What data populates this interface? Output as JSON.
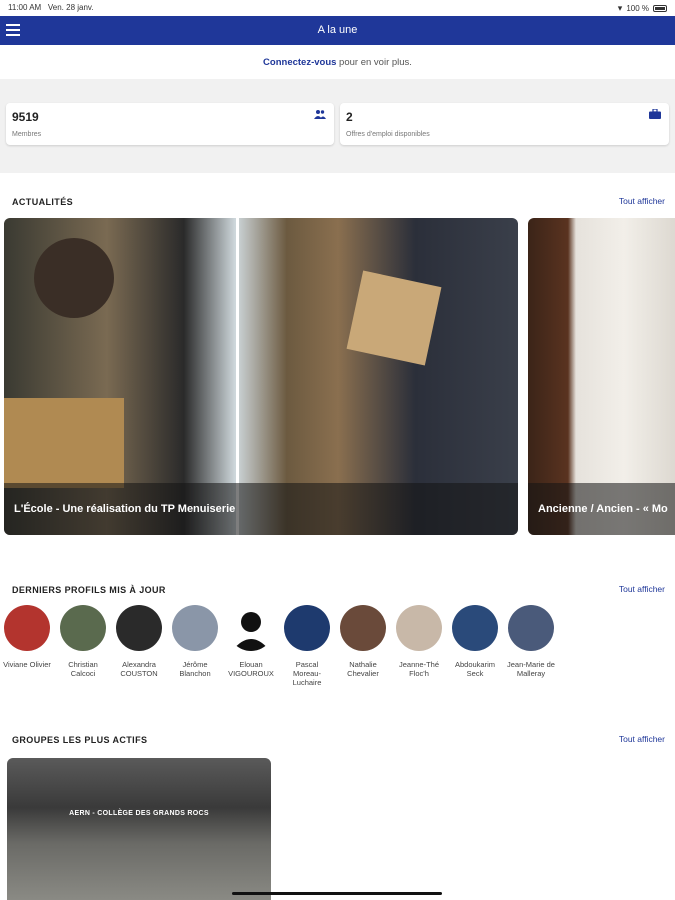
{
  "status": {
    "time": "11:00 AM",
    "date": "Ven. 28 janv.",
    "battery": "100 %"
  },
  "appbar": {
    "title": "A la une"
  },
  "connect": {
    "link": "Connectez-vous",
    "rest": " pour en voir plus."
  },
  "stats": {
    "members": {
      "value": "9519",
      "label": "Membres",
      "icon": "people-icon"
    },
    "jobs": {
      "value": "2",
      "label": "Offres d'emploi disponibles",
      "icon": "briefcase-icon"
    }
  },
  "news": {
    "title": "ACTUALITÉS",
    "see_all": "Tout afficher",
    "items": [
      {
        "caption": "L'École - Une réalisation du TP Menuiserie"
      },
      {
        "caption": "Ancienne / Ancien - « Mo"
      }
    ]
  },
  "profiles": {
    "title": "DERNIERS PROFILS MIS À JOUR",
    "see_all": "Tout afficher",
    "items": [
      {
        "name": "Viviane Olivier",
        "color": "#b3342e"
      },
      {
        "name": "Christian Calcoci",
        "color": "#5a6a4e"
      },
      {
        "name": "Alexandra COUSTON",
        "color": "#2a2a2a"
      },
      {
        "name": "Jérôme Blanchon",
        "color": "#8a96a8"
      },
      {
        "name": "Elouan VIGOUROUX",
        "color": "#111111"
      },
      {
        "name": "Pascal Moreau-Luchaire",
        "color": "#1e3a6e"
      },
      {
        "name": "Nathalie Chevalier",
        "color": "#6a4a3a"
      },
      {
        "name": "Jeanne-Thé Floc'h",
        "color": "#c8b8a8"
      },
      {
        "name": "Abdoukarim Seck",
        "color": "#2a4a7a"
      },
      {
        "name": "Jean-Marie de Malleray",
        "color": "#4a5a7a"
      }
    ]
  },
  "groups": {
    "title": "GROUPES LES PLUS ACTIFS",
    "see_all": "Tout afficher",
    "items": [
      {
        "title": "AERN - COLLÈGE DES GRANDS ROCS"
      }
    ]
  }
}
